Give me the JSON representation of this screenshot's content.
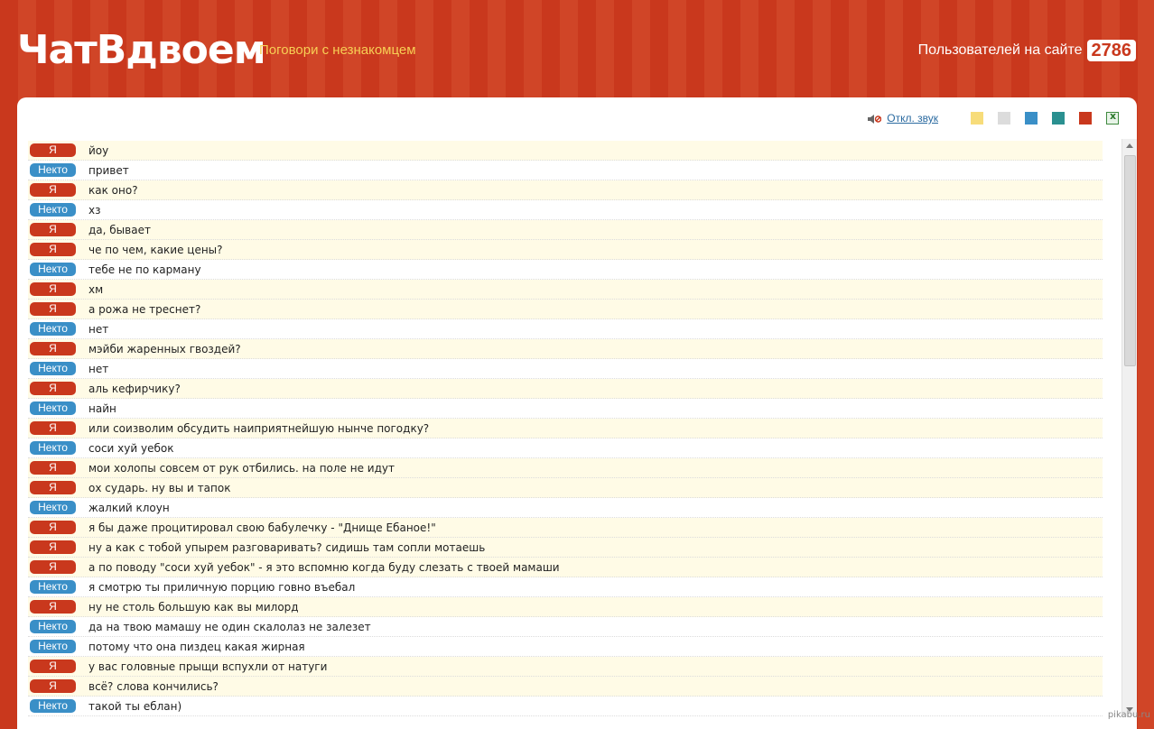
{
  "header": {
    "logo": "ЧатВдвоем",
    "tagline": "Поговори с незнакомцем",
    "users_label": "Пользователей на сайте",
    "users_count": "2786"
  },
  "toolbar": {
    "sound_toggle": "Откл. звук",
    "sound_icon": "speaker-mute-icon",
    "export_icon": "excel-icon",
    "theme_swatches": [
      "#f7dc7a",
      "#dcdcdc",
      "#3a8fc7",
      "#2a9090",
      "#c9381d"
    ]
  },
  "labels": {
    "me": "Я",
    "other": "Некто"
  },
  "colors": {
    "me_badge": "#c9381d",
    "other_badge": "#3a8fc7",
    "me_row": "#fffbe6"
  },
  "messages": [
    {
      "from": "me",
      "text": "йоу"
    },
    {
      "from": "other",
      "text": "привет"
    },
    {
      "from": "me",
      "text": "как оно?"
    },
    {
      "from": "other",
      "text": "хз"
    },
    {
      "from": "me",
      "text": "да, бывает"
    },
    {
      "from": "me",
      "text": "че по чем, какие цены?"
    },
    {
      "from": "other",
      "text": "тебе не по карману"
    },
    {
      "from": "me",
      "text": "хм"
    },
    {
      "from": "me",
      "text": "а рожа не треснет?"
    },
    {
      "from": "other",
      "text": "нет"
    },
    {
      "from": "me",
      "text": "мэйби жаренных гвоздей?"
    },
    {
      "from": "other",
      "text": "нет"
    },
    {
      "from": "me",
      "text": "аль кефирчику?"
    },
    {
      "from": "other",
      "text": "найн"
    },
    {
      "from": "me",
      "text": "или соизволим обсудить наиприятнейшую нынче погодку?"
    },
    {
      "from": "other",
      "text": "соси хуй уебок"
    },
    {
      "from": "me",
      "text": "мои холопы совсем от рук отбились. на поле не идут"
    },
    {
      "from": "me",
      "text": "ох сударь. ну вы и тапок"
    },
    {
      "from": "other",
      "text": "жалкий клоун"
    },
    {
      "from": "me",
      "text": "я бы даже процитировал свою бабулечку - \"Днище Ебаное!\""
    },
    {
      "from": "me",
      "text": "ну а как с тобой упырем разговаривать? сидишь там сопли мотаешь"
    },
    {
      "from": "me",
      "text": "а по поводу \"соси хуй уебок\" - я это вспомню когда буду слезать с твоей мамаши"
    },
    {
      "from": "other",
      "text": "я смотрю ты приличную порцию говно въебал"
    },
    {
      "from": "me",
      "text": "ну не столь большую как вы милорд"
    },
    {
      "from": "other",
      "text": "да на твою мамашу не один скалолаз не залезет"
    },
    {
      "from": "other",
      "text": "потому что она пиздец какая жирная"
    },
    {
      "from": "me",
      "text": "у вас головные прыщи вспухли от натуги"
    },
    {
      "from": "me",
      "text": "всё? слова кончились?"
    },
    {
      "from": "other",
      "text": "такой ты еблан)"
    }
  ],
  "watermark": "pikabu.ru"
}
